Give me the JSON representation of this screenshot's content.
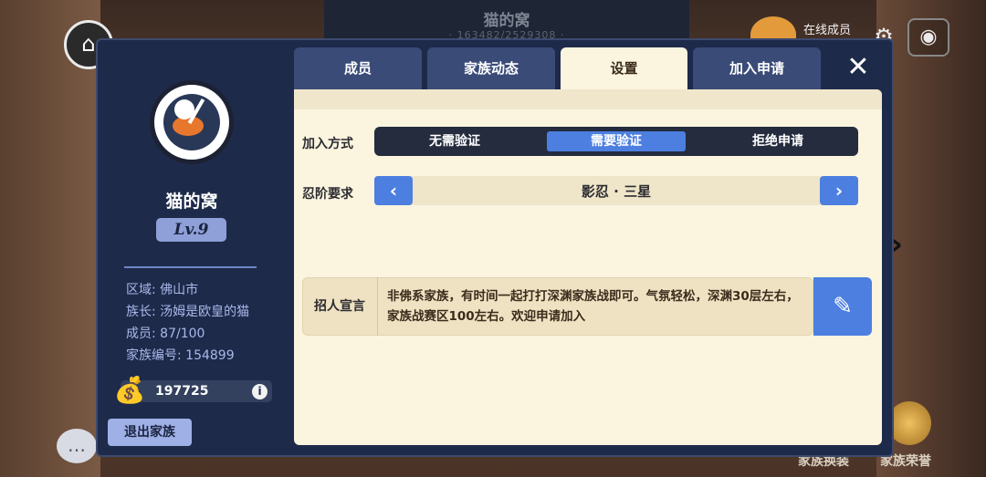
{
  "background": {
    "title": "猫的窝",
    "sub": "· 163482/2529308 ·",
    "online_label": "在线成员",
    "bottom_labels": [
      "家族换装",
      "家族荣誉"
    ],
    "icons": [
      "home-icon",
      "gear-icon",
      "eye-icon",
      "chat-icon",
      "trophy-icon",
      "right-arrow-icon"
    ]
  },
  "clan": {
    "name": "猫的窝",
    "level": "Lv.9",
    "region": "区域: 佛山市",
    "leader": "族长: 汤姆是欧皇的猫",
    "members": "成员: 87/100",
    "clan_id": "家族编号: 154899",
    "coins": "197725",
    "quit_label": "退出家族"
  },
  "tabs": [
    {
      "label": "成员",
      "active": false
    },
    {
      "label": "家族动态",
      "active": false
    },
    {
      "label": "设置",
      "active": true
    },
    {
      "label": "加入申请",
      "active": false
    }
  ],
  "settings": {
    "join_label": "加入方式",
    "join_options": [
      "无需验证",
      "需要验证",
      "拒绝申请"
    ],
    "join_selected": "需要验证",
    "rank_label": "忍阶要求",
    "rank_value": "影忍 · 三星",
    "slogan_label": "招人宣言",
    "slogan_text": "非佛系家族，有时间一起打打深渊家族战即可。气氛轻松，深渊30层左右，家族战赛区100左右。欢迎申请加入"
  },
  "colors": {
    "panel": "#1e2a4a",
    "tab": "#3a4b78",
    "tab_active": "#fbf4df",
    "accent": "#4c7fe0",
    "info_text": "#a9b8ea"
  }
}
